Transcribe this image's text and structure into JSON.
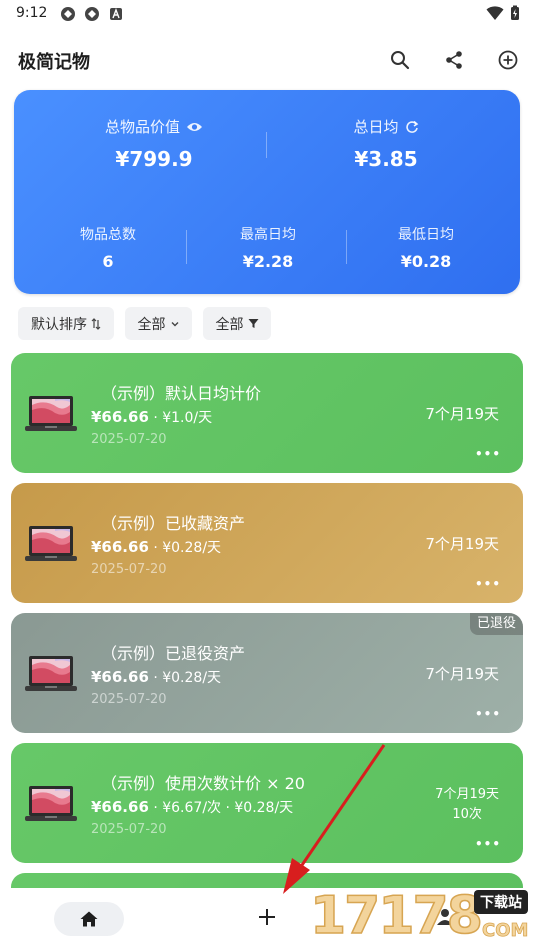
{
  "status_bar": {
    "time": "9:12"
  },
  "app_bar": {
    "title": "极简记物",
    "actions": [
      "search-icon",
      "share-icon",
      "add-circle-icon"
    ]
  },
  "summary": {
    "total_value_label": "总物品价值",
    "total_value": "¥799.9",
    "daily_avg_label": "总日均",
    "daily_avg": "¥3.85",
    "count_label": "物品总数",
    "count": "6",
    "max_daily_label": "最高日均",
    "max_daily": "¥2.28",
    "min_daily_label": "最低日均",
    "min_daily": "¥0.28"
  },
  "filters": {
    "sort": "默认排序",
    "category": "全部",
    "status": "全部"
  },
  "items": [
    {
      "title": "（示例）默认日均计价",
      "price": "¥66.66",
      "rate": " · ¥1.0/天",
      "date": "2025-07-20",
      "duration": "7个月19天",
      "color": "#5fc262"
    },
    {
      "title": "（示例）已收藏资产",
      "price": "¥66.66",
      "rate": " · ¥0.28/天",
      "date": "2025-07-20",
      "duration": "7个月19天",
      "color": "#cfa85a"
    },
    {
      "title": "（示例）已退役资产",
      "price": "¥66.66",
      "rate": " · ¥0.28/天",
      "date": "2025-07-20",
      "duration": "7个月19天",
      "badge": "已退役",
      "color": "#94a59e"
    },
    {
      "title": "（示例）使用次数计价 × 20",
      "price": "¥66.66",
      "rate": " · ¥6.67/次 · ¥0.28/天",
      "date": "2025-07-20",
      "duration": "7个月19天",
      "uses": "10次",
      "color": "#5fc262"
    }
  ],
  "more_label": "•••",
  "watermark": {
    "number": "17178",
    "tag": "下载站",
    "domain": "COM"
  }
}
